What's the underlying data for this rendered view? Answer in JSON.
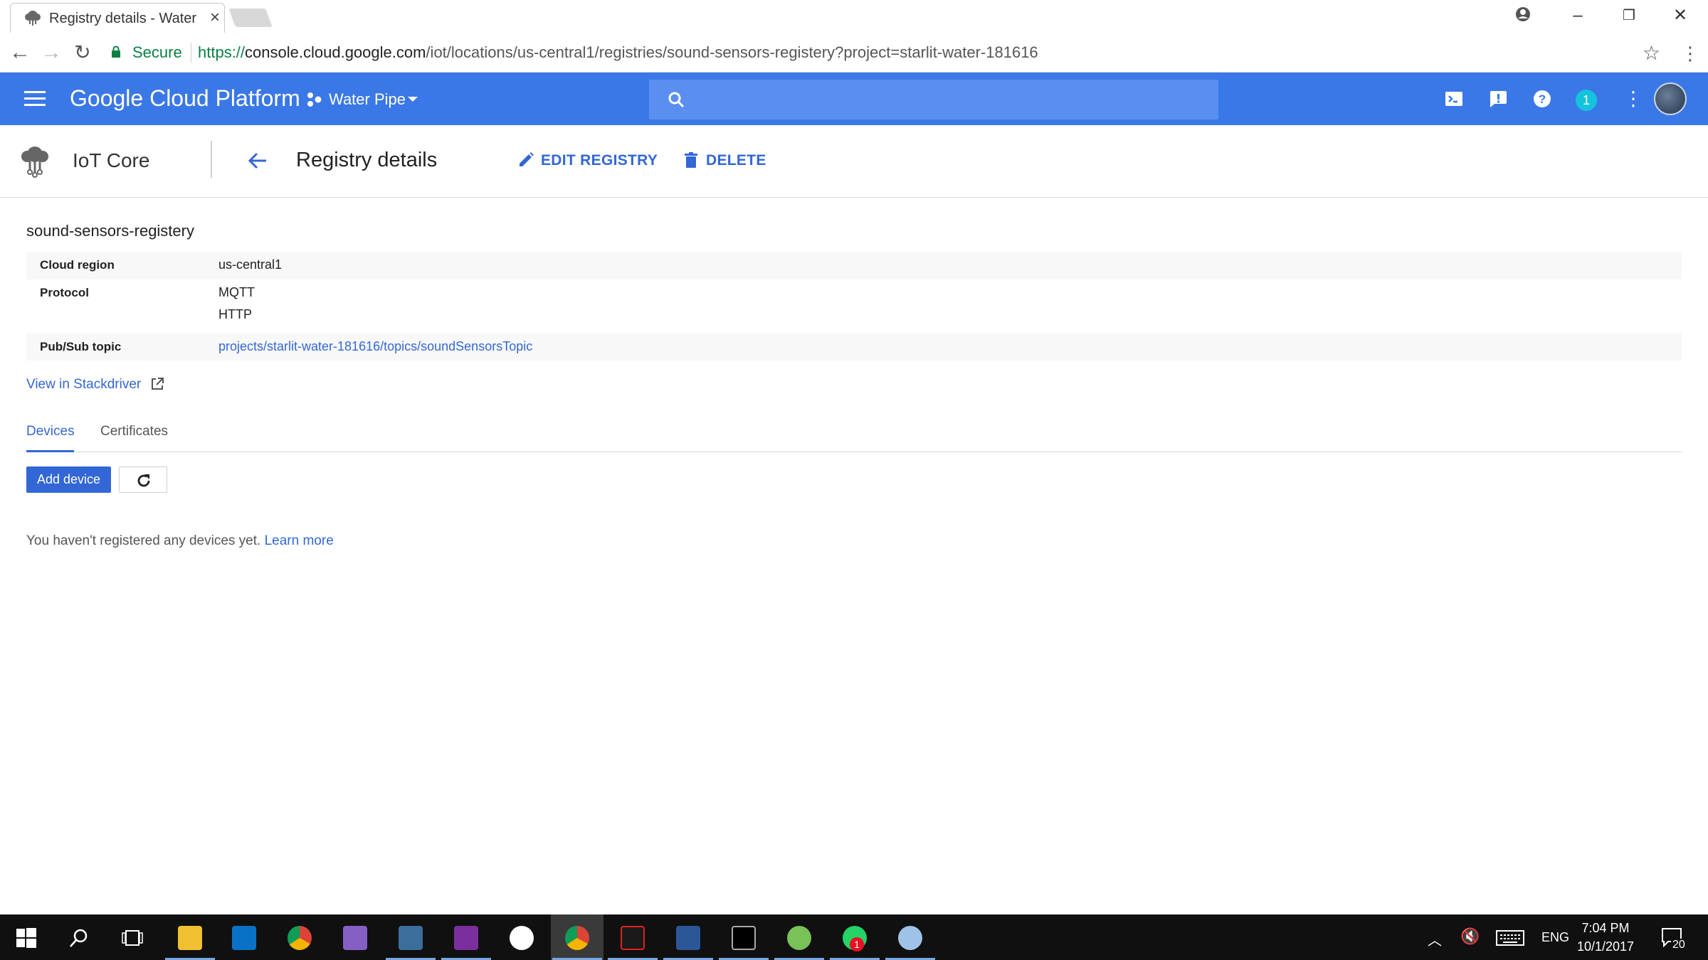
{
  "browser": {
    "tab_title": "Registry details - Water P",
    "url_secure_label": "Secure",
    "url_scheme": "https://",
    "url_host": "console.cloud.google.com",
    "url_path": "/iot/locations/us-central1/registries/sound-sensors-registery?project=starlit-water-181616"
  },
  "header": {
    "brand": "Google Cloud Platform",
    "project_name": "Water Pipe",
    "notification_count": "1",
    "search_placeholder": ""
  },
  "subheader": {
    "service": "IoT Core",
    "page_title": "Registry details",
    "edit_label": "EDIT REGISTRY",
    "delete_label": "DELETE"
  },
  "registry": {
    "name": "sound-sensors-registery",
    "rows": [
      {
        "key": "Cloud region",
        "values": [
          "us-central1"
        ]
      },
      {
        "key": "Protocol",
        "values": [
          "MQTT",
          "HTTP"
        ]
      },
      {
        "key": "Pub/Sub topic",
        "values": [
          "projects/starlit-water-181616/topics/soundSensorsTopic"
        ]
      }
    ],
    "stackdriver_link": "View in Stackdriver"
  },
  "tabs": [
    {
      "label": "Devices",
      "active": true
    },
    {
      "label": "Certificates",
      "active": false
    }
  ],
  "devices": {
    "add_label": "Add device",
    "empty_text": "You haven't registered any devices yet.",
    "learn_more": "Learn more"
  },
  "taskbar": {
    "time": "7:04 PM",
    "date": "10/1/2017",
    "lang": "ENG",
    "notif_count": "20",
    "whatsapp_badge": "1"
  },
  "colors": {
    "gcp_blue": "#3b78e7",
    "link_blue": "#3367d6",
    "secure_green": "#0b8043"
  }
}
